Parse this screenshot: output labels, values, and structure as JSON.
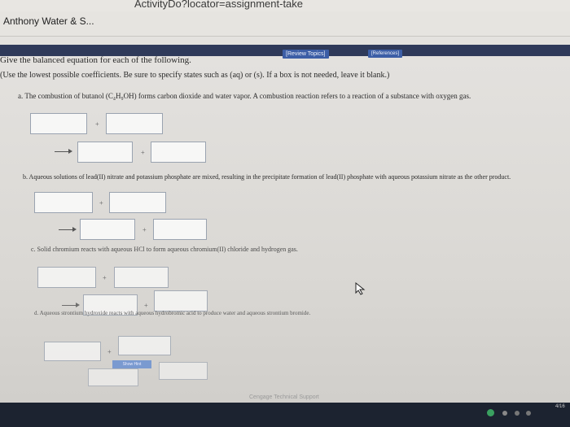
{
  "browser": {
    "url": "ActivityDo?locator=assignment-take",
    "tab_title": "Anthony Water & S..."
  },
  "toolbar": {
    "review_label": "[Review Topics]",
    "references_label": "[References]"
  },
  "question": {
    "title": "Give the balanced equation for each of the following.",
    "instructions": "(Use the lowest possible coefficients. Be sure to specify states such as (aq) or (s). If a box is not needed, leave it blank.)",
    "parts": [
      {
        "label": "a. The combustion of butanol (C₄H₉OH) forms carbon dioxide and water vapor. A combustion reaction refers to a reaction of a substance with oxygen gas."
      },
      {
        "label": "b. Aqueous solutions of lead(II) nitrate and potassium phosphate are mixed, resulting in the precipitate formation of lead(II) phosphate with aqueous potassium nitrate as the other product."
      },
      {
        "label": "c. Solid chromium reacts with aqueous HCl to form aqueous chromium(II) chloride and hydrogen gas."
      },
      {
        "label": "d. Aqueous strontium hydroxide reacts with aqueous hydrobromic acid to produce water and aqueous strontium bromide."
      }
    ],
    "plus_sign": "+",
    "hint_button": "Show Hint"
  },
  "footer": {
    "support_text": "Cengage Technical Support",
    "clock": "4/16"
  },
  "colors": {
    "accent": "#3c5ea6",
    "page_bg": "#dcdad6",
    "taskbar": "#1c2330"
  },
  "icons": [
    "cursor-arrow-icon",
    "tray-icons"
  ]
}
